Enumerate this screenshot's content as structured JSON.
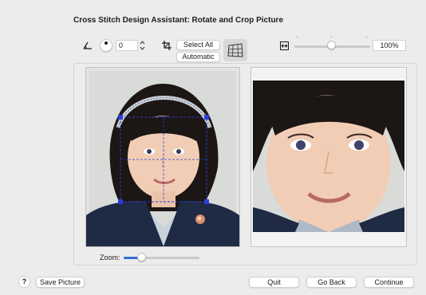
{
  "window": {
    "title": "Cross Stitch Design Assistant: Rotate and Crop Picture"
  },
  "toolbar": {
    "angle_icon": "angle-icon",
    "angle_value": "0",
    "crop_icon": "crop-icon",
    "select_all_label": "Select All",
    "automatic_label": "Automatic",
    "perspective_icon": "perspective-grid-icon",
    "fit_icon": "fit-width-icon",
    "zoom_percent": "100%",
    "zoom_slider_fraction": 0.45
  },
  "preview": {
    "left_description": "source-photo",
    "right_description": "cropped-preview"
  },
  "zoom": {
    "label": "Zoom:",
    "fraction": 0.18
  },
  "footer": {
    "help_label": "?",
    "save_label": "Save Picture",
    "quit_label": "Quit",
    "goback_label": "Go Back",
    "continue_label": "Continue"
  },
  "colors": {
    "accent": "#2f6fd6",
    "crop_outline": "#2a3fd6",
    "window_bg": "#ececec"
  }
}
